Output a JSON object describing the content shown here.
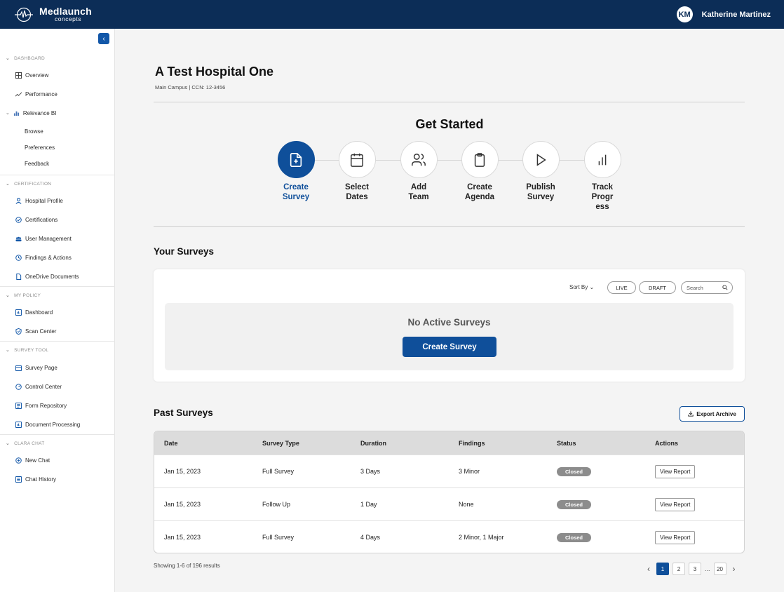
{
  "header": {
    "logo_main": "Medlaunch",
    "logo_sub": "concepts",
    "user_initials": "KM",
    "user_name": "Katherine Martinez"
  },
  "sidebar": {
    "sections": {
      "dashboard": "DASHBOARD",
      "certification": "CERTIFICATION",
      "my_policy": "MY POLICY",
      "survey_tool": "SURVEY TOOL",
      "clara_chat": "CLARA CHAT"
    },
    "items": {
      "overview": "Overview",
      "performance": "Performance",
      "relevance_bi": "Relevance BI",
      "browse": "Browse",
      "preferences": "Preferences",
      "feedback": "Feedback",
      "hospital_profile": "Hospital Profile",
      "certifications": "Certifications",
      "user_management": "User Management",
      "findings_actions": "Findings & Actions",
      "onedrive_documents": "OneDrive Documents",
      "policy_dashboard": "Dashboard",
      "scan_center": "Scan Center",
      "survey_page": "Survey Page",
      "control_center": "Control Center",
      "form_repository": "Form Repository",
      "document_processing": "Document Processing",
      "new_chat": "New Chat",
      "chat_history": "Chat History"
    }
  },
  "hospital": {
    "name": "A Test Hospital One",
    "subtitle": "Main Campus | CCN: 12-3456"
  },
  "get_started": {
    "title": "Get Started",
    "steps": [
      {
        "line1": "Create",
        "line2": "Survey",
        "line3": ""
      },
      {
        "line1": "Select",
        "line2": "Dates",
        "line3": ""
      },
      {
        "line1": "Add",
        "line2": "Team",
        "line3": ""
      },
      {
        "line1": "Create",
        "line2": "Agenda",
        "line3": ""
      },
      {
        "line1": "Publish",
        "line2": "Survey",
        "line3": ""
      },
      {
        "line1": "Track",
        "line2": "Progr",
        "line3": "ess"
      }
    ]
  },
  "your_surveys": {
    "title": "Your Surveys",
    "sort_by": "Sort By",
    "filter_live": "LIVE",
    "filter_draft": "DRAFT",
    "search_placeholder": "Search",
    "empty_text": "No Active Surveys",
    "create_button": "Create Survey"
  },
  "past_surveys": {
    "title": "Past Surveys",
    "export_button": "Export Archive",
    "columns": [
      "Date",
      "Survey Type",
      "Duration",
      "Findings",
      "Status",
      "Actions"
    ],
    "rows": [
      {
        "date": "Jan 15, 2023",
        "type": "Full Survey",
        "duration": "3 Days",
        "findings": "3 Minor",
        "status": "Closed",
        "action": "View Report"
      },
      {
        "date": "Jan 15, 2023",
        "type": "Follow Up",
        "duration": "1 Day",
        "findings": "None",
        "status": "Closed",
        "action": "View Report"
      },
      {
        "date": "Jan 15, 2023",
        "type": "Full Survey",
        "duration": "4 Days",
        "findings": "2 Minor, 1 Major",
        "status": "Closed",
        "action": "View Report"
      }
    ],
    "showing": "Showing 1-6 of 196 results",
    "pages": [
      "1",
      "2",
      "3"
    ],
    "ellipsis": "...",
    "last_page": "20"
  }
}
